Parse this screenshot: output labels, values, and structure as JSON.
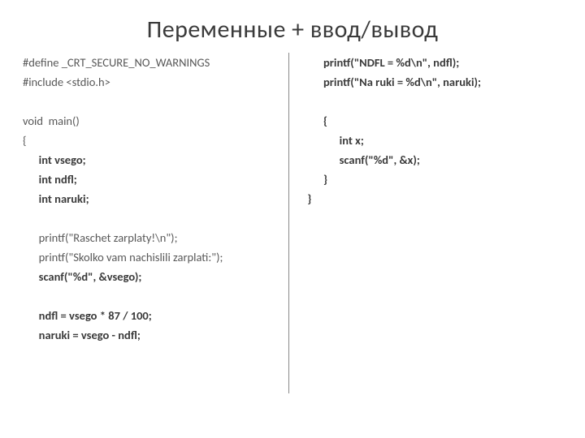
{
  "title": "Переменные + ввод/вывод",
  "left": {
    "l0": "#define _CRT_SECURE_NO_WARNINGS",
    "l1": "#include <stdio.h>",
    "l2": "void  main()",
    "l3": "{",
    "l4": "      int vsego;",
    "l5": "      int ndfl;",
    "l6": "      int naruki;",
    "l7": "      printf(\"Raschet zarplaty!\\n\");",
    "l8": "      printf(\"Skolko vam nachislili zarplati:\");",
    "l9": "      scanf(\"%d\", &vsego);",
    "l10": "      ndfl = vsego * 87 / 100;",
    "l11": "      naruki = vsego - ndfl;"
  },
  "right": {
    "r0": "      printf(\"NDFL = %d\\n\", ndfl);",
    "r1": "      printf(\"Na ruki = %d\\n\", naruki);",
    "r2": "      {",
    "r3": "            int x;",
    "r4": "            scanf(\"%d\", &x);",
    "r5": "      }",
    "r6": "}"
  }
}
